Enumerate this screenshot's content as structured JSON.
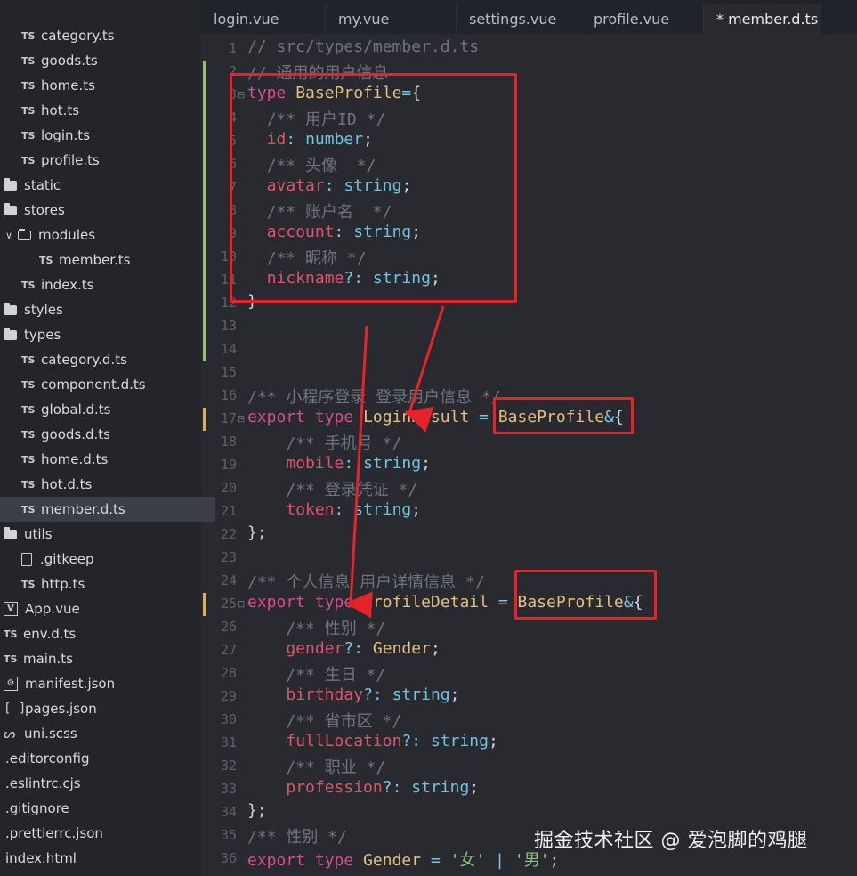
{
  "sidebar": {
    "items": [
      {
        "type": "ts",
        "label": "category.ts",
        "indent": 24
      },
      {
        "type": "ts",
        "label": "goods.ts",
        "indent": 24
      },
      {
        "type": "ts",
        "label": "home.ts",
        "indent": 24
      },
      {
        "type": "ts",
        "label": "hot.ts",
        "indent": 24
      },
      {
        "type": "ts",
        "label": "login.ts",
        "indent": 24
      },
      {
        "type": "ts",
        "label": "profile.ts",
        "indent": 24
      },
      {
        "type": "folder",
        "label": "static",
        "indent": 4
      },
      {
        "type": "folder",
        "label": "stores",
        "indent": 4
      },
      {
        "type": "folder-open",
        "label": "modules",
        "indent": 6
      },
      {
        "type": "ts",
        "label": "member.ts",
        "indent": 44
      },
      {
        "type": "ts",
        "label": "index.ts",
        "indent": 24
      },
      {
        "type": "folder",
        "label": "styles",
        "indent": 4
      },
      {
        "type": "folder",
        "label": "types",
        "indent": 4
      },
      {
        "type": "ts",
        "label": "category.d.ts",
        "indent": 24
      },
      {
        "type": "ts",
        "label": "component.d.ts",
        "indent": 24
      },
      {
        "type": "ts",
        "label": "global.d.ts",
        "indent": 24
      },
      {
        "type": "ts",
        "label": "goods.d.ts",
        "indent": 24
      },
      {
        "type": "ts",
        "label": "home.d.ts",
        "indent": 24
      },
      {
        "type": "ts",
        "label": "hot.d.ts",
        "indent": 24
      },
      {
        "type": "ts",
        "label": "member.d.ts",
        "indent": 24,
        "selected": true
      },
      {
        "type": "folder",
        "label": "utils",
        "indent": 4
      },
      {
        "type": "file",
        "label": ".gitkeep",
        "indent": 24
      },
      {
        "type": "ts",
        "label": "http.ts",
        "indent": 24
      },
      {
        "type": "vue",
        "label": "App.vue",
        "indent": 4
      },
      {
        "type": "ts",
        "label": "env.d.ts",
        "indent": 4
      },
      {
        "type": "ts",
        "label": "main.ts",
        "indent": 4
      },
      {
        "type": "gear",
        "label": "manifest.json",
        "indent": 4
      },
      {
        "type": "bracket",
        "label": "pages.json",
        "indent": 4
      },
      {
        "type": "sass",
        "label": "uni.scss",
        "indent": 4
      },
      {
        "type": "plain",
        "label": ".editorconfig",
        "indent": 6
      },
      {
        "type": "plain",
        "label": ".eslintrc.cjs",
        "indent": 6
      },
      {
        "type": "plain",
        "label": ".gitignore",
        "indent": 6
      },
      {
        "type": "plain",
        "label": ".prettierrc.json",
        "indent": 6
      },
      {
        "type": "plain",
        "label": "index.html",
        "indent": 6
      }
    ],
    "ts_badge": "TS",
    "vue_badge": "V",
    "gear_badge": "⚙",
    "bracket_badge": "[ ]",
    "sass_badge": "ᔕ",
    "chevron": "∨"
  },
  "tabs": [
    {
      "label": "login.vue",
      "active": false
    },
    {
      "label": "my.vue",
      "active": false
    },
    {
      "label": "settings.vue",
      "active": false
    },
    {
      "label": "profile.vue",
      "active": false
    },
    {
      "label": "* member.d.ts",
      "active": true
    }
  ],
  "editor": {
    "lines": [
      {
        "n": "1",
        "tokens": [
          [
            "cmt",
            "// src/types/member.d.ts"
          ]
        ]
      },
      {
        "n": "2",
        "tokens": [
          [
            "cmt",
            "// 通用的用户信息"
          ]
        ]
      },
      {
        "n": "3",
        "tokens": [
          [
            "kw",
            "type"
          ],
          [
            "punc",
            " "
          ],
          [
            "tp",
            "BaseProfile"
          ],
          [
            "op",
            "="
          ],
          [
            "punc",
            "{"
          ]
        ]
      },
      {
        "n": "4",
        "tokens": [
          [
            "punc",
            "  "
          ],
          [
            "cmt",
            "/** 用户ID */"
          ]
        ]
      },
      {
        "n": "5",
        "tokens": [
          [
            "punc",
            "  "
          ],
          [
            "prop",
            "id"
          ],
          [
            "op",
            ":"
          ],
          [
            "punc",
            " "
          ],
          [
            "prim",
            "number"
          ],
          [
            "punc",
            ";"
          ]
        ]
      },
      {
        "n": "6",
        "tokens": [
          [
            "punc",
            "  "
          ],
          [
            "cmt",
            "/** 头像  */"
          ]
        ]
      },
      {
        "n": "7",
        "tokens": [
          [
            "punc",
            "  "
          ],
          [
            "prop",
            "avatar"
          ],
          [
            "op",
            ":"
          ],
          [
            "punc",
            " "
          ],
          [
            "prim",
            "string"
          ],
          [
            "punc",
            ";"
          ]
        ]
      },
      {
        "n": "8",
        "tokens": [
          [
            "punc",
            "  "
          ],
          [
            "cmt",
            "/** 账户名  */"
          ]
        ]
      },
      {
        "n": "9",
        "tokens": [
          [
            "punc",
            "  "
          ],
          [
            "prop",
            "account"
          ],
          [
            "op",
            ":"
          ],
          [
            "punc",
            " "
          ],
          [
            "prim",
            "string"
          ],
          [
            "punc",
            ";"
          ]
        ]
      },
      {
        "n": "10",
        "tokens": [
          [
            "punc",
            "  "
          ],
          [
            "cmt",
            "/** 昵称 */"
          ]
        ]
      },
      {
        "n": "11",
        "tokens": [
          [
            "punc",
            "  "
          ],
          [
            "prop",
            "nickname"
          ],
          [
            "op",
            "?:"
          ],
          [
            "punc",
            " "
          ],
          [
            "prim",
            "string"
          ],
          [
            "punc",
            ";"
          ]
        ]
      },
      {
        "n": "12",
        "tokens": [
          [
            "punc",
            "}"
          ]
        ]
      },
      {
        "n": "13",
        "tokens": []
      },
      {
        "n": "14",
        "tokens": []
      },
      {
        "n": "15",
        "tokens": []
      },
      {
        "n": "16",
        "tokens": [
          [
            "cmt",
            "/** 小程序登录 登录用户信息 */"
          ]
        ]
      },
      {
        "n": "17",
        "tokens": [
          [
            "kw",
            "export"
          ],
          [
            "punc",
            " "
          ],
          [
            "kw",
            "type"
          ],
          [
            "punc",
            " "
          ],
          [
            "tp",
            "LoginResult"
          ],
          [
            "punc",
            " "
          ],
          [
            "op",
            "="
          ],
          [
            "punc",
            " "
          ],
          [
            "tp",
            "BaseProfile"
          ],
          [
            "op",
            "&"
          ],
          [
            "punc",
            "{"
          ]
        ]
      },
      {
        "n": "18",
        "tokens": [
          [
            "punc",
            "    "
          ],
          [
            "cmt",
            "/** 手机号 */"
          ]
        ]
      },
      {
        "n": "19",
        "tokens": [
          [
            "punc",
            "    "
          ],
          [
            "prop",
            "mobile"
          ],
          [
            "op",
            ":"
          ],
          [
            "punc",
            " "
          ],
          [
            "prim",
            "string"
          ],
          [
            "punc",
            ";"
          ]
        ]
      },
      {
        "n": "20",
        "tokens": [
          [
            "punc",
            "    "
          ],
          [
            "cmt",
            "/** 登录凭证 */"
          ]
        ]
      },
      {
        "n": "21",
        "tokens": [
          [
            "punc",
            "    "
          ],
          [
            "prop",
            "token"
          ],
          [
            "op",
            ":"
          ],
          [
            "punc",
            " "
          ],
          [
            "prim",
            "string"
          ],
          [
            "punc",
            ";"
          ]
        ]
      },
      {
        "n": "22",
        "tokens": [
          [
            "punc",
            "};"
          ]
        ]
      },
      {
        "n": "23",
        "tokens": []
      },
      {
        "n": "24",
        "tokens": [
          [
            "cmt",
            "/** 个人信息 用户详情信息 */"
          ]
        ]
      },
      {
        "n": "25",
        "tokens": [
          [
            "kw",
            "export"
          ],
          [
            "punc",
            " "
          ],
          [
            "kw",
            "type"
          ],
          [
            "punc",
            " "
          ],
          [
            "tp",
            "ProfileDetail"
          ],
          [
            "punc",
            " "
          ],
          [
            "op",
            "="
          ],
          [
            "punc",
            " "
          ],
          [
            "tp",
            "BaseProfile"
          ],
          [
            "op",
            "&"
          ],
          [
            "punc",
            "{"
          ]
        ]
      },
      {
        "n": "26",
        "tokens": [
          [
            "punc",
            "    "
          ],
          [
            "cmt",
            "/** 性别 */"
          ]
        ]
      },
      {
        "n": "27",
        "tokens": [
          [
            "punc",
            "    "
          ],
          [
            "prop",
            "gender"
          ],
          [
            "op",
            "?:"
          ],
          [
            "punc",
            " "
          ],
          [
            "tp",
            "Gender"
          ],
          [
            "punc",
            ";"
          ]
        ]
      },
      {
        "n": "28",
        "tokens": [
          [
            "punc",
            "    "
          ],
          [
            "cmt",
            "/** 生日 */"
          ]
        ]
      },
      {
        "n": "29",
        "tokens": [
          [
            "punc",
            "    "
          ],
          [
            "prop",
            "birthday"
          ],
          [
            "op",
            "?:"
          ],
          [
            "punc",
            " "
          ],
          [
            "prim",
            "string"
          ],
          [
            "punc",
            ";"
          ]
        ]
      },
      {
        "n": "30",
        "tokens": [
          [
            "punc",
            "    "
          ],
          [
            "cmt",
            "/** 省市区 */"
          ]
        ]
      },
      {
        "n": "31",
        "tokens": [
          [
            "punc",
            "    "
          ],
          [
            "prop",
            "fullLocation"
          ],
          [
            "op",
            "?:"
          ],
          [
            "punc",
            " "
          ],
          [
            "prim",
            "string"
          ],
          [
            "punc",
            ";"
          ]
        ]
      },
      {
        "n": "32",
        "tokens": [
          [
            "punc",
            "    "
          ],
          [
            "cmt",
            "/** 职业 */"
          ]
        ]
      },
      {
        "n": "33",
        "tokens": [
          [
            "punc",
            "    "
          ],
          [
            "prop",
            "profession"
          ],
          [
            "op",
            "?:"
          ],
          [
            "punc",
            " "
          ],
          [
            "prim",
            "string"
          ],
          [
            "punc",
            ";"
          ]
        ]
      },
      {
        "n": "34",
        "tokens": [
          [
            "punc",
            "};"
          ]
        ]
      },
      {
        "n": "35",
        "tokens": [
          [
            "cmt",
            "/** 性别 */"
          ]
        ]
      },
      {
        "n": "36",
        "tokens": [
          [
            "kw",
            "export"
          ],
          [
            "punc",
            " "
          ],
          [
            "kw",
            "type"
          ],
          [
            "punc",
            " "
          ],
          [
            "tp",
            "Gender"
          ],
          [
            "punc",
            " "
          ],
          [
            "op",
            "="
          ],
          [
            "punc",
            " "
          ],
          [
            "str",
            "'女'"
          ],
          [
            "punc",
            " "
          ],
          [
            "op",
            "|"
          ],
          [
            "punc",
            " "
          ],
          [
            "str",
            "'男'"
          ],
          [
            "punc",
            ";"
          ]
        ]
      }
    ]
  },
  "watermark": "掘金技术社区 @ 爱泡脚的鸡腿",
  "colors": {
    "annotation_red": "#e8222b",
    "modified_green": "#8fc46a",
    "modified_orange": "#e2b04a"
  }
}
